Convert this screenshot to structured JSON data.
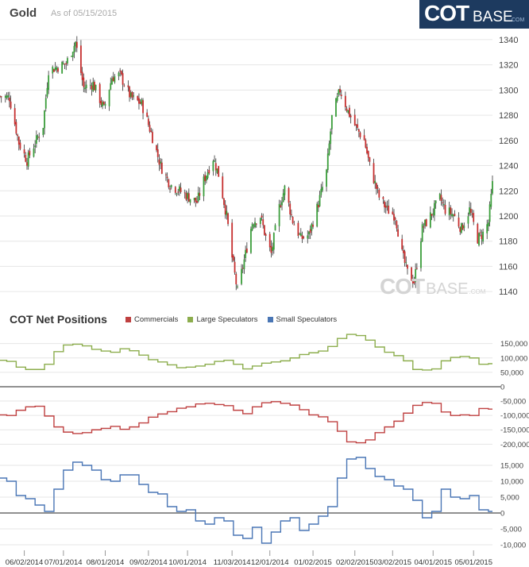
{
  "header": {
    "title": "Gold",
    "as_of": "As of 05/15/2015"
  },
  "logo": {
    "cot": "COT",
    "base": "BASE",
    "com": ".COM"
  },
  "watermark": {
    "cot": "COT",
    "base": "BASE",
    "com": ".COM"
  },
  "colors": {
    "up": "#3a9d3a",
    "down": "#c62f2f",
    "commercials": "#bf4040",
    "large_speculators": "#8cad4d",
    "small_speculators": "#4a76b5",
    "grid": "#e6e6e6"
  },
  "chart_data": [
    {
      "type": "candlestick",
      "title": "Gold",
      "x_ticks": [
        "06/02/2014",
        "07/01/2014",
        "08/01/2014",
        "09/02/2014",
        "10/01/2014",
        "11/03/2014",
        "12/01/2014",
        "01/02/2015",
        "02/02/2015",
        "03/02/2015",
        "04/01/2015",
        "05/01/2015"
      ],
      "x_range": [
        "05/15/2014",
        "05/15/2015"
      ],
      "y_ticks": [
        1140,
        1160,
        1180,
        1200,
        1220,
        1240,
        1260,
        1280,
        1300,
        1320,
        1340
      ],
      "ylim": [
        1130,
        1345
      ],
      "grid": true,
      "close_path": [
        [
          "05/15/2014",
          1295
        ],
        [
          "05/22/2014",
          1294
        ],
        [
          "05/29/2014",
          1258
        ],
        [
          "06/04/2014",
          1244
        ],
        [
          "06/10/2014",
          1258
        ],
        [
          "06/16/2014",
          1272
        ],
        [
          "06/20/2014",
          1316
        ],
        [
          "06/26/2014",
          1318
        ],
        [
          "07/03/2014",
          1321
        ],
        [
          "07/10/2014",
          1338
        ],
        [
          "07/16/2014",
          1302
        ],
        [
          "07/23/2014",
          1305
        ],
        [
          "07/31/2014",
          1285
        ],
        [
          "08/06/2014",
          1310
        ],
        [
          "08/12/2014",
          1312
        ],
        [
          "08/20/2014",
          1294
        ],
        [
          "08/28/2014",
          1289
        ],
        [
          "09/04/2014",
          1266
        ],
        [
          "09/11/2014",
          1240
        ],
        [
          "09/18/2014",
          1225
        ],
        [
          "09/25/2014",
          1220
        ],
        [
          "10/02/2014",
          1215
        ],
        [
          "10/08/2014",
          1211
        ],
        [
          "10/13/2014",
          1228
        ],
        [
          "10/20/2014",
          1246
        ],
        [
          "10/24/2014",
          1233
        ],
        [
          "10/30/2014",
          1200
        ],
        [
          "11/03/2014",
          1167
        ],
        [
          "11/07/2014",
          1140
        ],
        [
          "11/12/2014",
          1165
        ],
        [
          "11/18/2014",
          1195
        ],
        [
          "11/24/2014",
          1200
        ],
        [
          "11/28/2014",
          1183
        ],
        [
          "12/02/2014",
          1170
        ],
        [
          "12/08/2014",
          1207
        ],
        [
          "12/12/2014",
          1222
        ],
        [
          "12/18/2014",
          1196
        ],
        [
          "12/24/2014",
          1182
        ],
        [
          "12/30/2014",
          1185
        ],
        [
          "01/06/2015",
          1210
        ],
        [
          "01/12/2015",
          1235
        ],
        [
          "01/16/2015",
          1278
        ],
        [
          "01/22/2015",
          1300
        ],
        [
          "01/28/2015",
          1283
        ],
        [
          "02/03/2015",
          1270
        ],
        [
          "02/09/2015",
          1260
        ],
        [
          "02/13/2015",
          1240
        ],
        [
          "02/20/2015",
          1215
        ],
        [
          "02/26/2015",
          1205
        ],
        [
          "03/04/2015",
          1200
        ],
        [
          "03/09/2015",
          1170
        ],
        [
          "03/13/2015",
          1155
        ],
        [
          "03/18/2015",
          1148
        ],
        [
          "03/24/2015",
          1190
        ],
        [
          "03/30/2015",
          1200
        ],
        [
          "04/06/2015",
          1214
        ],
        [
          "04/10/2015",
          1205
        ],
        [
          "04/16/2015",
          1201
        ],
        [
          "04/22/2015",
          1190
        ],
        [
          "04/28/2015",
          1205
        ],
        [
          "05/04/2015",
          1182
        ],
        [
          "05/08/2015",
          1186
        ],
        [
          "05/12/2015",
          1195
        ],
        [
          "05/15/2015",
          1225
        ]
      ]
    },
    {
      "type": "line",
      "title": "COT Net Positions",
      "legend_position": "top",
      "x_ticks": [
        "06/02/2014",
        "07/01/2014",
        "08/01/2014",
        "09/02/2014",
        "10/01/2014",
        "11/03/2014",
        "12/01/2014",
        "01/02/2015",
        "02/02/2015",
        "03/02/2015",
        "04/01/2015",
        "05/01/2015"
      ],
      "x_range": [
        "05/15/2014",
        "05/15/2015"
      ],
      "step": true,
      "series": [
        {
          "name": "Commercials",
          "panel": "upper",
          "values": [
            [
              "05/13/2014",
              -98000
            ],
            [
              "05/20/2014",
              -100000
            ],
            [
              "05/27/2014",
              -82000
            ],
            [
              "06/03/2014",
              -70000
            ],
            [
              "06/10/2014",
              -68000
            ],
            [
              "06/17/2014",
              -102000
            ],
            [
              "06/24/2014",
              -140000
            ],
            [
              "07/01/2014",
              -158000
            ],
            [
              "07/08/2014",
              -163000
            ],
            [
              "07/15/2014",
              -160000
            ],
            [
              "07/22/2014",
              -150000
            ],
            [
              "07/29/2014",
              -145000
            ],
            [
              "08/05/2014",
              -138000
            ],
            [
              "08/12/2014",
              -148000
            ],
            [
              "08/19/2014",
              -140000
            ],
            [
              "08/26/2014",
              -126000
            ],
            [
              "09/02/2014",
              -106000
            ],
            [
              "09/09/2014",
              -95000
            ],
            [
              "09/16/2014",
              -87000
            ],
            [
              "09/23/2014",
              -75000
            ],
            [
              "09/30/2014",
              -70000
            ],
            [
              "10/07/2014",
              -60000
            ],
            [
              "10/14/2014",
              -58000
            ],
            [
              "10/21/2014",
              -62000
            ],
            [
              "10/28/2014",
              -66000
            ],
            [
              "11/04/2014",
              -82000
            ],
            [
              "11/11/2014",
              -94000
            ],
            [
              "11/18/2014",
              -70000
            ],
            [
              "11/25/2014",
              -56000
            ],
            [
              "12/02/2014",
              -52000
            ],
            [
              "12/09/2014",
              -58000
            ],
            [
              "12/16/2014",
              -64000
            ],
            [
              "12/23/2014",
              -80000
            ],
            [
              "12/30/2014",
              -98000
            ],
            [
              "01/06/2015",
              -105000
            ],
            [
              "01/13/2015",
              -122000
            ],
            [
              "01/20/2015",
              -155000
            ],
            [
              "01/27/2015",
              -192000
            ],
            [
              "02/03/2015",
              -195000
            ],
            [
              "02/10/2015",
              -185000
            ],
            [
              "02/17/2015",
              -160000
            ],
            [
              "02/24/2015",
              -140000
            ],
            [
              "03/03/2015",
              -120000
            ],
            [
              "03/10/2015",
              -92000
            ],
            [
              "03/17/2015",
              -65000
            ],
            [
              "03/24/2015",
              -55000
            ],
            [
              "03/31/2015",
              -58000
            ],
            [
              "04/07/2015",
              -88000
            ],
            [
              "04/14/2015",
              -100000
            ],
            [
              "04/21/2015",
              -98000
            ],
            [
              "04/28/2015",
              -100000
            ],
            [
              "05/05/2015",
              -76000
            ],
            [
              "05/12/2015",
              -78000
            ]
          ]
        },
        {
          "name": "Large Speculators",
          "panel": "upper",
          "values": [
            [
              "05/13/2014",
              92000
            ],
            [
              "05/20/2014",
              88000
            ],
            [
              "05/27/2014",
              68000
            ],
            [
              "06/03/2014",
              60000
            ],
            [
              "06/10/2014",
              60000
            ],
            [
              "06/17/2014",
              78000
            ],
            [
              "06/24/2014",
              122000
            ],
            [
              "07/01/2014",
              145000
            ],
            [
              "07/08/2014",
              148000
            ],
            [
              "07/15/2014",
              142000
            ],
            [
              "07/22/2014",
              130000
            ],
            [
              "07/29/2014",
              124000
            ],
            [
              "08/05/2014",
              120000
            ],
            [
              "08/12/2014",
              132000
            ],
            [
              "08/19/2014",
              125000
            ],
            [
              "08/26/2014",
              110000
            ],
            [
              "09/02/2014",
              94000
            ],
            [
              "09/09/2014",
              86000
            ],
            [
              "09/16/2014",
              76000
            ],
            [
              "09/23/2014",
              66000
            ],
            [
              "09/30/2014",
              68000
            ],
            [
              "10/07/2014",
              72000
            ],
            [
              "10/14/2014",
              78000
            ],
            [
              "10/21/2014",
              88000
            ],
            [
              "10/28/2014",
              92000
            ],
            [
              "11/04/2014",
              78000
            ],
            [
              "11/11/2014",
              62000
            ],
            [
              "11/18/2014",
              72000
            ],
            [
              "11/25/2014",
              82000
            ],
            [
              "12/02/2014",
              86000
            ],
            [
              "12/09/2014",
              90000
            ],
            [
              "12/16/2014",
              100000
            ],
            [
              "12/23/2014",
              112000
            ],
            [
              "12/30/2014",
              118000
            ],
            [
              "01/06/2015",
              124000
            ],
            [
              "01/13/2015",
              140000
            ],
            [
              "01/20/2015",
              168000
            ],
            [
              "01/27/2015",
              182000
            ],
            [
              "02/03/2015",
              178000
            ],
            [
              "02/10/2015",
              162000
            ],
            [
              "02/17/2015",
              138000
            ],
            [
              "02/24/2015",
              120000
            ],
            [
              "03/03/2015",
              108000
            ],
            [
              "03/10/2015",
              90000
            ],
            [
              "03/17/2015",
              60000
            ],
            [
              "03/24/2015",
              58000
            ],
            [
              "03/31/2015",
              62000
            ],
            [
              "04/07/2015",
              90000
            ],
            [
              "04/14/2015",
              102000
            ],
            [
              "04/21/2015",
              105000
            ],
            [
              "04/28/2015",
              100000
            ],
            [
              "05/05/2015",
              78000
            ],
            [
              "05/12/2015",
              80000
            ]
          ]
        },
        {
          "name": "Small Speculators",
          "panel": "lower",
          "values": [
            [
              "05/13/2014",
              11000
            ],
            [
              "05/20/2014",
              10000
            ],
            [
              "05/27/2014",
              5500
            ],
            [
              "06/03/2014",
              4500
            ],
            [
              "06/10/2014",
              2500
            ],
            [
              "06/17/2014",
              500
            ],
            [
              "06/24/2014",
              7500
            ],
            [
              "07/01/2014",
              13500
            ],
            [
              "07/08/2014",
              16000
            ],
            [
              "07/15/2014",
              15000
            ],
            [
              "07/22/2014",
              13500
            ],
            [
              "07/29/2014",
              10500
            ],
            [
              "08/05/2014",
              10000
            ],
            [
              "08/12/2014",
              12000
            ],
            [
              "08/19/2014",
              12000
            ],
            [
              "08/26/2014",
              9000
            ],
            [
              "09/02/2014",
              6500
            ],
            [
              "09/09/2014",
              6000
            ],
            [
              "09/16/2014",
              2000
            ],
            [
              "09/23/2014",
              500
            ],
            [
              "09/30/2014",
              1000
            ],
            [
              "10/07/2014",
              -2500
            ],
            [
              "10/14/2014",
              -3500
            ],
            [
              "10/21/2014",
              -1500
            ],
            [
              "10/28/2014",
              -2500
            ],
            [
              "11/04/2014",
              -7000
            ],
            [
              "11/11/2014",
              -8000
            ],
            [
              "11/18/2014",
              -4500
            ],
            [
              "11/25/2014",
              -9500
            ],
            [
              "12/02/2014",
              -6000
            ],
            [
              "12/09/2014",
              -2500
            ],
            [
              "12/16/2014",
              -1500
            ],
            [
              "12/23/2014",
              -5500
            ],
            [
              "12/30/2014",
              -3500
            ],
            [
              "01/06/2015",
              -1000
            ],
            [
              "01/13/2015",
              2000
            ],
            [
              "01/20/2015",
              11000
            ],
            [
              "01/27/2015",
              17000
            ],
            [
              "02/03/2015",
              17500
            ],
            [
              "02/10/2015",
              14000
            ],
            [
              "02/17/2015",
              11500
            ],
            [
              "02/24/2015",
              10500
            ],
            [
              "03/03/2015",
              8500
            ],
            [
              "03/10/2015",
              7500
            ],
            [
              "03/17/2015",
              4000
            ],
            [
              "03/24/2015",
              -1500
            ],
            [
              "03/31/2015",
              500
            ],
            [
              "04/07/2015",
              7500
            ],
            [
              "04/14/2015",
              5000
            ],
            [
              "04/21/2015",
              4500
            ],
            [
              "04/28/2015",
              5500
            ],
            [
              "05/05/2015",
              1000
            ],
            [
              "05/12/2015",
              500
            ]
          ]
        }
      ],
      "upper_y_ticks": [
        "150,000",
        "100,000",
        "50,000",
        "0",
        "-50,000",
        "-100,000",
        "-150,000",
        "-200,000"
      ],
      "upper_y_values": [
        150000,
        100000,
        50000,
        0,
        -50000,
        -100000,
        -150000,
        -200000
      ],
      "upper_ylim": [
        -235000,
        185000
      ],
      "lower_y_ticks": [
        "15,000",
        "10,000",
        "5,000",
        "0",
        "-5,000",
        "-10,000"
      ],
      "lower_y_values": [
        15000,
        10000,
        5000,
        0,
        -5000,
        -10000
      ],
      "lower_ylim": [
        -11500,
        20000
      ]
    }
  ]
}
